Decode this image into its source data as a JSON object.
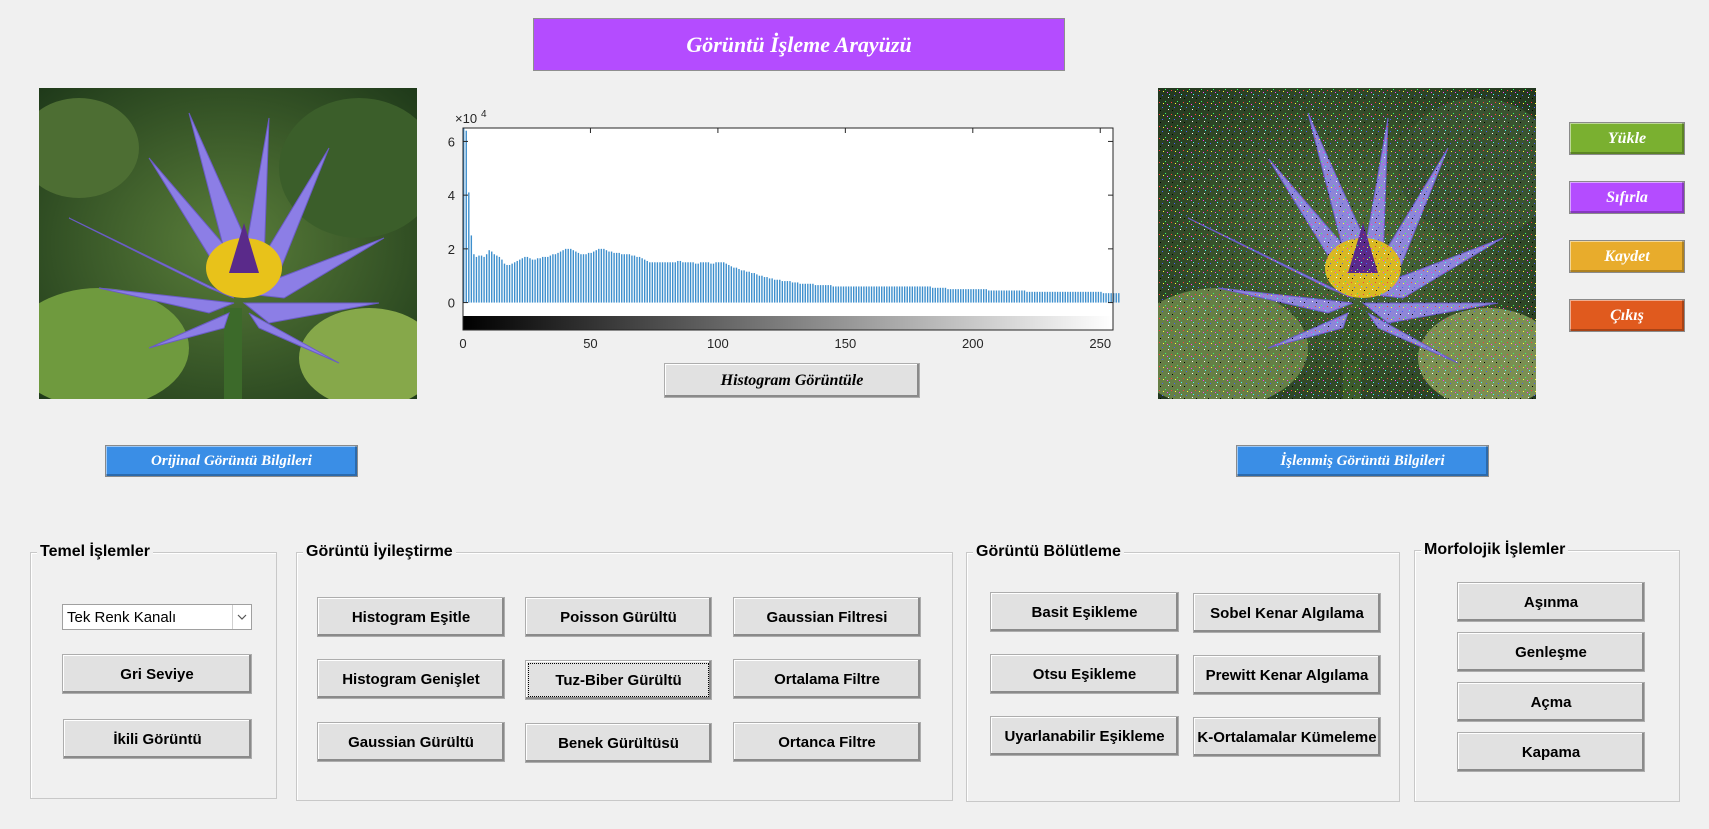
{
  "header": {
    "title": "Görüntü İşleme Arayüzü"
  },
  "buttons_main": {
    "load": "Yükle",
    "reset": "Sıfırla",
    "save": "Kaydet",
    "exit": "Çıkış",
    "histogram_show": "Histogram Görüntüle",
    "original_info": "Orijinal Görüntü Bilgileri",
    "processed_info": "İşlenmiş Görüntü Bilgileri"
  },
  "colors": {
    "title": "#b44cff",
    "load": "#7ab030",
    "reset": "#b44cff",
    "save": "#e8ac2c",
    "exit": "#e05a1e",
    "info": "#3a8ee6",
    "histogram_bar": "#3d8fcd"
  },
  "histogram": {
    "exponent_label": "×10",
    "exponent_power": "4",
    "y_ticks": [
      "6",
      "4",
      "2",
      "0"
    ],
    "x_ticks": [
      "0",
      "50",
      "100",
      "150",
      "200",
      "250"
    ]
  },
  "chart_data": {
    "type": "bar",
    "xlim": [
      0,
      255
    ],
    "ylim": [
      -0.5,
      6.5
    ],
    "y_scale_note": "×10^4",
    "x": "0..255",
    "values": [
      6.5,
      6.4,
      4.1,
      2.5,
      1.8,
      1.7,
      1.75,
      1.75,
      1.7,
      1.8,
      1.95,
      1.9,
      1.8,
      1.75,
      1.7,
      1.6,
      1.45,
      1.4,
      1.4,
      1.45,
      1.5,
      1.55,
      1.6,
      1.65,
      1.7,
      1.7,
      1.65,
      1.6,
      1.6,
      1.65,
      1.65,
      1.7,
      1.7,
      1.7,
      1.75,
      1.8,
      1.8,
      1.85,
      1.9,
      1.95,
      2.0,
      2.0,
      2.0,
      1.95,
      1.9,
      1.85,
      1.8,
      1.8,
      1.8,
      1.85,
      1.85,
      1.9,
      1.95,
      2.0,
      2.0,
      2.0,
      1.95,
      1.9,
      1.9,
      1.85,
      1.85,
      1.85,
      1.8,
      1.8,
      1.8,
      1.8,
      1.75,
      1.75,
      1.7,
      1.7,
      1.65,
      1.6,
      1.55,
      1.5,
      1.5,
      1.5,
      1.5,
      1.5,
      1.5,
      1.5,
      1.5,
      1.5,
      1.5,
      1.5,
      1.55,
      1.55,
      1.5,
      1.5,
      1.5,
      1.5,
      1.5,
      1.45,
      1.45,
      1.5,
      1.5,
      1.5,
      1.5,
      1.45,
      1.45,
      1.5,
      1.5,
      1.5,
      1.5,
      1.45,
      1.4,
      1.35,
      1.3,
      1.3,
      1.25,
      1.2,
      1.2,
      1.15,
      1.15,
      1.1,
      1.1,
      1.05,
      1.0,
      1.0,
      0.95,
      0.95,
      0.9,
      0.9,
      0.85,
      0.85,
      0.85,
      0.8,
      0.8,
      0.8,
      0.8,
      0.75,
      0.75,
      0.75,
      0.7,
      0.7,
      0.7,
      0.7,
      0.7,
      0.7,
      0.65,
      0.65,
      0.65,
      0.65,
      0.65,
      0.65,
      0.65,
      0.6,
      0.6,
      0.6,
      0.6,
      0.6,
      0.6,
      0.6,
      0.6,
      0.6,
      0.6,
      0.6,
      0.6,
      0.6,
      0.6,
      0.6,
      0.6,
      0.6,
      0.6,
      0.6,
      0.6,
      0.6,
      0.6,
      0.6,
      0.6,
      0.6,
      0.6,
      0.6,
      0.6,
      0.6,
      0.6,
      0.6,
      0.6,
      0.6,
      0.6,
      0.6,
      0.6,
      0.6,
      0.6,
      0.6,
      0.55,
      0.55,
      0.55,
      0.55,
      0.55,
      0.55,
      0.5,
      0.5,
      0.5,
      0.5,
      0.5,
      0.5,
      0.5,
      0.5,
      0.5,
      0.5,
      0.5,
      0.5,
      0.5,
      0.5,
      0.5,
      0.5,
      0.45,
      0.45,
      0.45,
      0.45,
      0.45,
      0.45,
      0.45,
      0.45,
      0.45,
      0.45,
      0.45,
      0.45,
      0.45,
      0.45,
      0.45,
      0.4,
      0.4,
      0.4,
      0.4,
      0.4,
      0.4,
      0.4,
      0.4,
      0.4,
      0.4,
      0.4,
      0.4,
      0.4,
      0.4,
      0.4,
      0.4,
      0.4,
      0.4,
      0.4,
      0.4,
      0.4,
      0.4,
      0.4,
      0.4,
      0.4,
      0.4,
      0.4,
      0.4,
      0.4,
      0.4,
      0.35,
      0.35,
      0.35,
      0.35,
      0.35,
      0.35,
      0.35,
      0.35,
      0.3,
      0.3
    ]
  },
  "panels": {
    "basic": {
      "title": "Temel İşlemler",
      "select_value": "Tek Renk Kanalı",
      "buttons": [
        "Gri Seviye",
        "İkili Görüntü"
      ]
    },
    "enhance": {
      "title": "Görüntü İyileştirme",
      "buttons": [
        "Histogram Eşitle",
        "Poisson Gürültü",
        "Gaussian Filtresi",
        "Histogram Genişlet",
        "Tuz-Biber Gürültü",
        "Ortalama Filtre",
        "Gaussian Gürültü",
        "Benek Gürültüsü",
        "Ortanca Filtre"
      ]
    },
    "segment": {
      "title": "Görüntü Bölütleme",
      "buttons": [
        "Basit Eşikleme",
        "Sobel Kenar Algılama",
        "Otsu Eşikleme",
        "Prewitt Kenar Algılama",
        "Uyarlanabilir Eşikleme",
        "K-Ortalamalar Kümeleme"
      ]
    },
    "morph": {
      "title": "Morfolojik İşlemler",
      "buttons": [
        "Aşınma",
        "Genleşme",
        "Açma",
        "Kapama"
      ]
    }
  }
}
